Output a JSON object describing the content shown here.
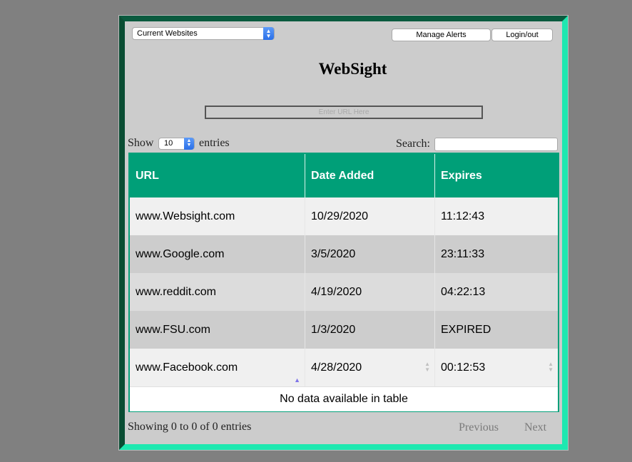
{
  "view_select": {
    "value": "Current Websites"
  },
  "header": {
    "manage_alerts_label": "Manage Alerts",
    "login_label": "Login/out",
    "title": "WebSight"
  },
  "url_input": {
    "placeholder": "Enter URL Here"
  },
  "controls": {
    "show_label": "Show",
    "page_length": "10",
    "entries_label": "entries",
    "search_label": "Search:"
  },
  "table": {
    "columns": [
      "URL",
      "Date Added",
      "Expires"
    ],
    "rows": [
      [
        "www.Websight.com",
        "10/29/2020",
        "11:12:43"
      ],
      [
        "www.Google.com",
        "3/5/2020",
        "23:11:33"
      ],
      [
        "www.reddit.com",
        "4/19/2020",
        "04:22:13"
      ],
      [
        "www.FSU.com",
        "1/3/2020",
        "EXPIRED"
      ],
      [
        "www.Facebook.com",
        "4/28/2020",
        "00:12:53"
      ]
    ],
    "empty_message": "No data available in table"
  },
  "footer": {
    "info": "Showing 0 to 0 of 0 entries",
    "previous_label": "Previous",
    "next_label": "Next"
  },
  "colors": {
    "header_bg": "#009f78",
    "frame_light": "#1ee8b0",
    "frame_dark": "#0a5a3e",
    "panel_bg": "#cccccc",
    "page_bg": "#808080"
  }
}
